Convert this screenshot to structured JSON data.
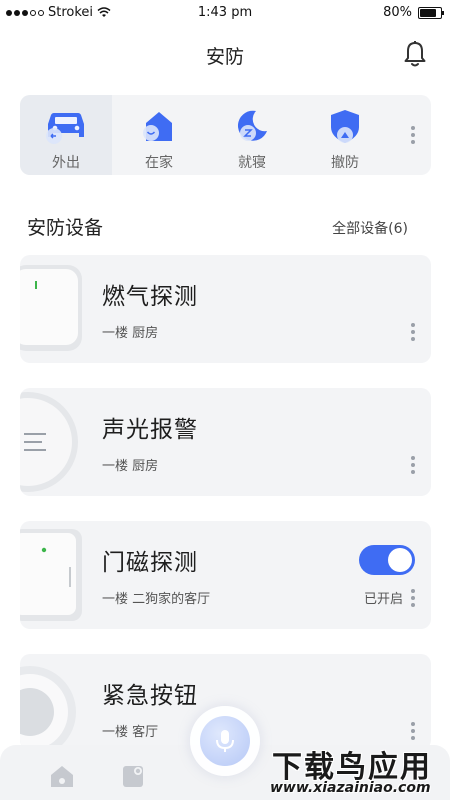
{
  "status_bar": {
    "carrier": "Strokei",
    "time": "1:43 pm",
    "battery": "80%",
    "battery_level": 0.8
  },
  "nav": {
    "title": "安防",
    "bell_icon": "bell-icon"
  },
  "modes": [
    {
      "label": "外出",
      "icon": "car-icon",
      "active": true
    },
    {
      "label": "在家",
      "icon": "home-icon",
      "active": false
    },
    {
      "label": "就寝",
      "icon": "moon-icon",
      "active": false
    },
    {
      "label": "撤防",
      "icon": "shield-icon",
      "active": false
    }
  ],
  "section": {
    "title": "安防设备",
    "link": "全部设备(6)"
  },
  "devices": [
    {
      "name": "燃气探测",
      "location": "一楼  厨房",
      "status": "",
      "icon": "gas-detector-icon"
    },
    {
      "name": "声光报警",
      "location": "一楼  厨房",
      "status": "",
      "icon": "siren-icon"
    },
    {
      "name": "门磁探测",
      "location": "一楼  二狗家的客厅",
      "status": "已开启",
      "icon": "door-sensor-icon",
      "toggle_on": true
    },
    {
      "name": "紧急按钮",
      "location": "一楼  客厅",
      "status": "",
      "icon": "emergency-button-icon"
    }
  ],
  "tabbar": {
    "items": [
      "home-icon",
      "devices-icon",
      "voice-mic-icon"
    ]
  },
  "watermark": {
    "title": "下载鸟应用",
    "url": "www.xiazainiao.com"
  },
  "colors": {
    "accent": "#3f6cf3",
    "card_bg": "#f3f4f6"
  }
}
